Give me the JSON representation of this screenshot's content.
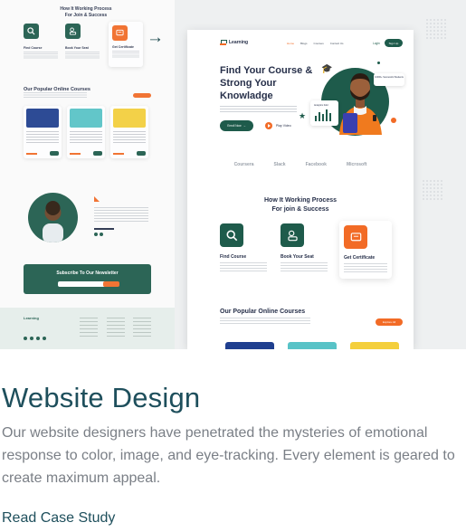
{
  "hero_image": {
    "left_page": {
      "how_title": "How It Working Process\nFor Join & Success",
      "cards": [
        "Find Course",
        "Book Your Seat",
        "Get Certificate"
      ],
      "courses_title": "Our Popular Online Courses",
      "newsletter_title": "Subscribe To Our Newsletter",
      "footer_logo": "Learning"
    },
    "right_page": {
      "logo": "Learning",
      "menu": [
        "Home",
        "Blogs",
        "Courses",
        "Contact Us"
      ],
      "login": "Login",
      "signup": "Sign Up",
      "hero_title": "Find Your Course & Strong Your Knowladge",
      "enroll": "Enroll Now",
      "play": "Play Video",
      "graph_label": "Analytics Fold",
      "student_card": "10000+ Successful Students",
      "brands": [
        "Coursera",
        "Slack",
        "Facebook",
        "Microsoft"
      ],
      "how_title": "How It Working Process\nFor join & Success",
      "how_cards": [
        "Find Course",
        "Book Your Seat",
        "Get Certificate"
      ],
      "popular_title": "Our Popular Online Courses",
      "explore": "Explore All"
    },
    "colors": {
      "primary": "#1e5b4b",
      "accent": "#f26b26",
      "heading": "#1e4f5c"
    }
  },
  "title": "Website Design",
  "description": "Our website designers have penetrated the mysteries of emotional response to color, image,  and eye-tracking. Every element is geared to create maximum appeal.",
  "link": "Read Case Study"
}
